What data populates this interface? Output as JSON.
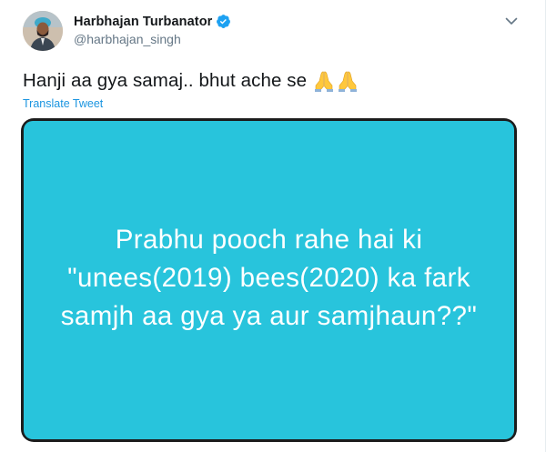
{
  "user": {
    "display_name": "Harbhajan Turbanator",
    "handle": "@harbhajan_singh",
    "verified": true
  },
  "tweet": {
    "text": "Hanji aa gya samaj.. bhut ache se",
    "emoji": [
      "folded-hands-emoji",
      "folded-hands-emoji"
    ],
    "translate_label": "Translate Tweet"
  },
  "media": {
    "lines": [
      "Prabhu pooch rahe hai ki",
      "\"unees(2019) bees(2020) ka fark",
      "samjh aa gya ya aur samjhaun??\""
    ],
    "background_color": "#28c4dc",
    "text_color": "#ffffff"
  },
  "icons": {
    "verified": "verified-badge-icon",
    "menu": "chevron-down-icon"
  },
  "colors": {
    "link": "#1b95e0",
    "text": "#14171a",
    "secondary": "#657786",
    "verified": "#1da1f2"
  }
}
